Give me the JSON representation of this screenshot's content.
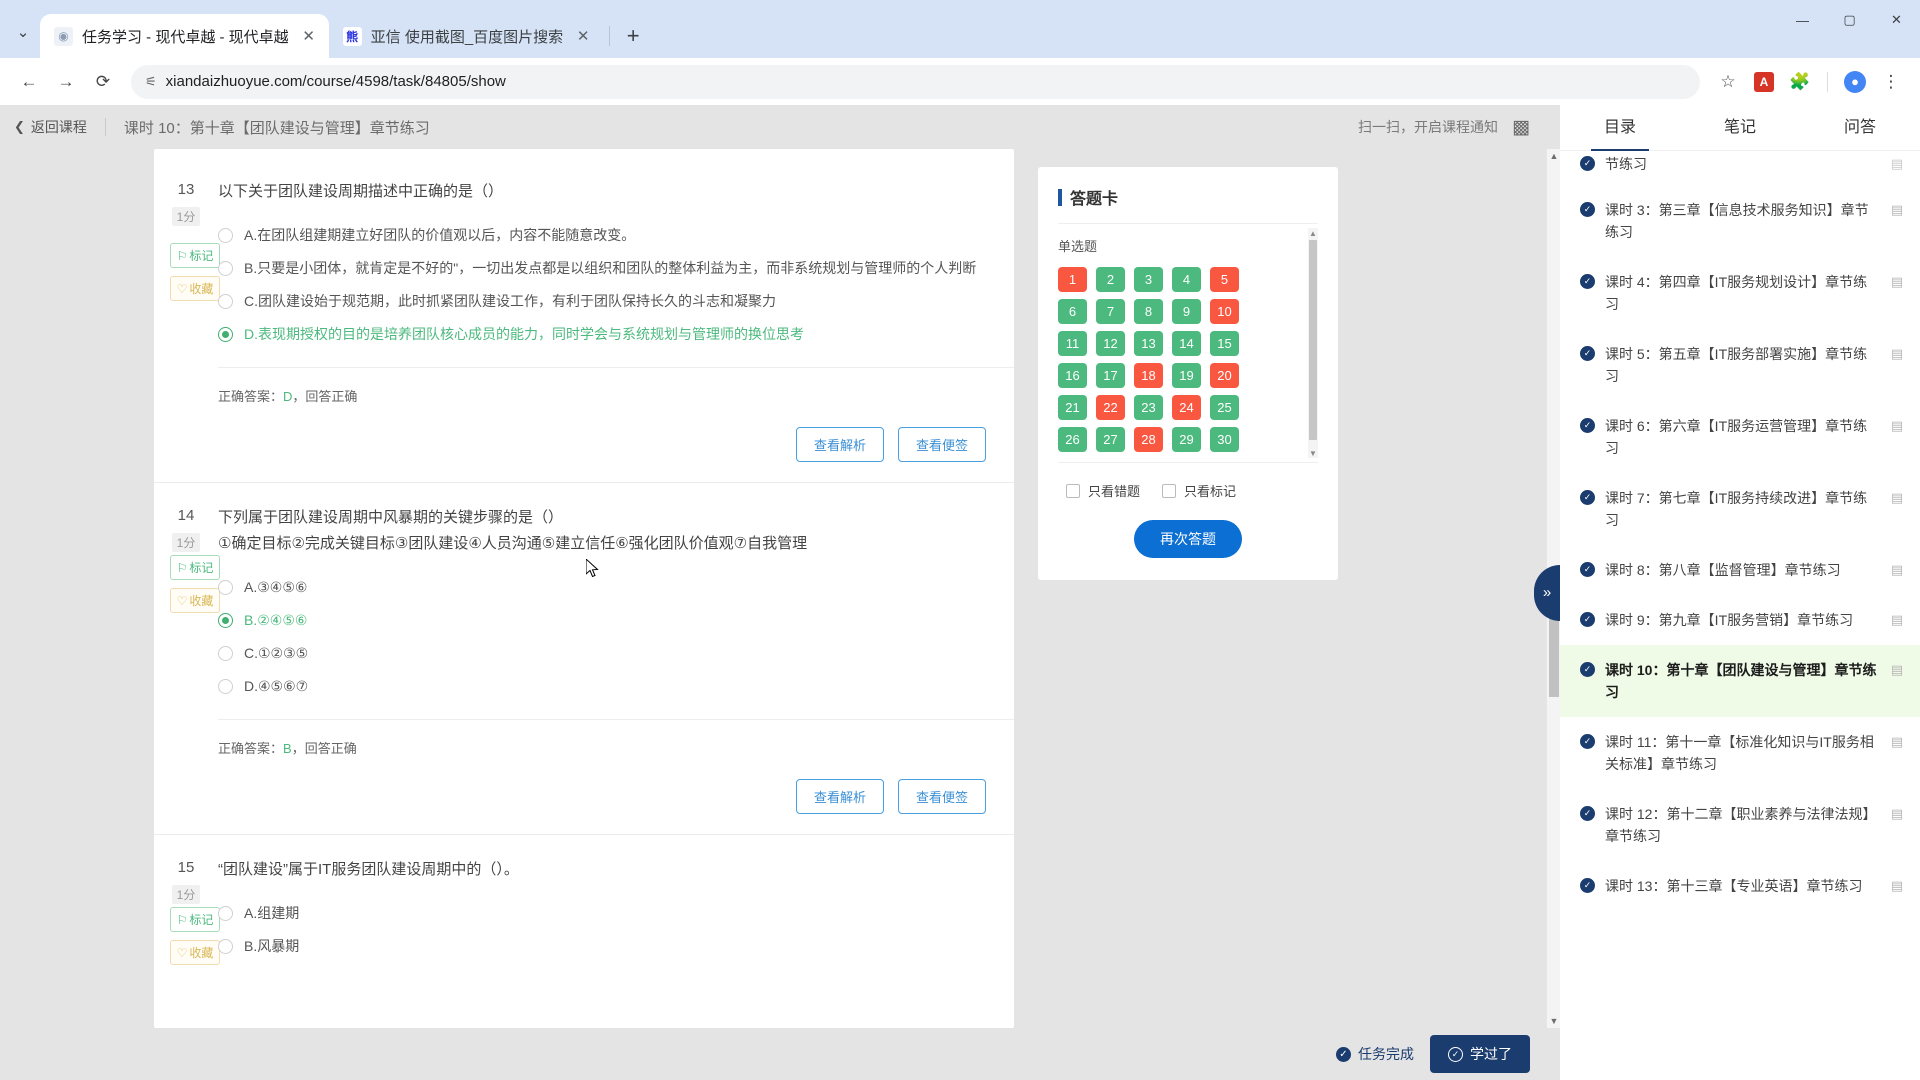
{
  "browser": {
    "tabs": [
      {
        "title": "任务学习 - 现代卓越 - 现代卓越",
        "favicon": "zhuoyue-icon",
        "active": true,
        "close_label": "✕"
      },
      {
        "title": "亚信 使用截图_百度图片搜索",
        "favicon": "baidu-icon",
        "active": false,
        "close_label": "✕"
      }
    ],
    "new_tab_label": "+",
    "tab_list_chevron": "⌄",
    "window_controls": {
      "minimize": "—",
      "maximize": "▢",
      "close": "✕"
    },
    "nav": {
      "back": "←",
      "forward": "→",
      "reload": "⟳"
    },
    "omnibox": {
      "url": "xiandaizhuoyue.com/course/4598/task/84805/show",
      "site_info_icon": "tune-icon"
    },
    "toolbar_right": {
      "bookmark": "☆",
      "pdf_ext": "PDF",
      "extensions": "⟐",
      "profile": "👤",
      "menu": "⋮"
    }
  },
  "page_header": {
    "back_label": "返回课程",
    "back_arrow": "❮",
    "title": "课时 10：第十章【团队建设与管理】章节练习",
    "scan_notice": "扫一扫，开启课程通知",
    "qr_icon": "qr-code-icon"
  },
  "questions": [
    {
      "number": "13",
      "score": "1分",
      "stem": "以下关于团队建设周期描述中正确的是（）",
      "stem2": "",
      "tags": [
        {
          "label": "标记",
          "icon": "flag-icon",
          "type": "mark"
        },
        {
          "label": "收藏",
          "icon": "heart-icon",
          "type": "favorite"
        }
      ],
      "options": [
        {
          "label": "A.在团队组建期建立好团队的价值观以后，内容不能随意改变。",
          "selected": false,
          "correct": false
        },
        {
          "label": "B.只要是小团体，就肯定是不好的\"，一切出发点都是以组织和团队的整体利益为主，而非系统规划与管理师的个人判断",
          "selected": false,
          "correct": false
        },
        {
          "label": "C.团队建设始于规范期，此时抓紧团队建设工作，有利于团队保持长久的斗志和凝聚力",
          "selected": false,
          "correct": false
        },
        {
          "label": "D.表现期授权的目的是培养团队核心成员的能力，同时学会与系统规划与管理师的换位思考",
          "selected": true,
          "correct": true
        }
      ],
      "answer_prefix": "正确答案：",
      "answer_key": "D",
      "answer_suffix": "，回答正确",
      "actions": [
        "查看解析",
        "查看便签"
      ]
    },
    {
      "number": "14",
      "score": "1分",
      "stem": "下列属于团队建设周期中风暴期的关键步骤的是（）",
      "stem2": "①确定目标②完成关键目标③团队建设④人员沟通⑤建立信任⑥强化团队价值观⑦自我管理",
      "tags": [
        {
          "label": "标记",
          "icon": "flag-icon",
          "type": "mark"
        },
        {
          "label": "收藏",
          "icon": "heart-icon",
          "type": "favorite"
        }
      ],
      "options": [
        {
          "label": "A.③④⑤⑥",
          "selected": false,
          "correct": false
        },
        {
          "label": "B.②④⑤⑥",
          "selected": true,
          "correct": true
        },
        {
          "label": "C.①②③⑤",
          "selected": false,
          "correct": false
        },
        {
          "label": "D.④⑤⑥⑦",
          "selected": false,
          "correct": false
        }
      ],
      "answer_prefix": "正确答案：",
      "answer_key": "B",
      "answer_suffix": "，回答正确",
      "actions": [
        "查看解析",
        "查看便签"
      ]
    },
    {
      "number": "15",
      "score": "1分",
      "stem": "“团队建设”属于IT服务团队建设周期中的（）。",
      "stem2": "",
      "tags": [
        {
          "label": "标记",
          "icon": "flag-icon",
          "type": "mark"
        }
      ],
      "options": [
        {
          "label": "A.组建期",
          "selected": false,
          "correct": false
        },
        {
          "label": "B.风暴期",
          "selected": false,
          "correct": false
        }
      ],
      "answer_prefix": "",
      "answer_key": "",
      "answer_suffix": "",
      "actions": []
    }
  ],
  "answer_card": {
    "title": "答题卡",
    "group_label": "单选题",
    "cells": [
      {
        "n": "1",
        "state": "bad"
      },
      {
        "n": "2",
        "state": "ok"
      },
      {
        "n": "3",
        "state": "ok"
      },
      {
        "n": "4",
        "state": "ok"
      },
      {
        "n": "5",
        "state": "bad"
      },
      {
        "n": "6",
        "state": "ok"
      },
      {
        "n": "7",
        "state": "ok"
      },
      {
        "n": "8",
        "state": "ok"
      },
      {
        "n": "9",
        "state": "ok"
      },
      {
        "n": "10",
        "state": "bad"
      },
      {
        "n": "11",
        "state": "ok"
      },
      {
        "n": "12",
        "state": "ok"
      },
      {
        "n": "13",
        "state": "ok"
      },
      {
        "n": "14",
        "state": "ok"
      },
      {
        "n": "15",
        "state": "ok"
      },
      {
        "n": "16",
        "state": "ok"
      },
      {
        "n": "17",
        "state": "ok"
      },
      {
        "n": "18",
        "state": "bad"
      },
      {
        "n": "19",
        "state": "ok"
      },
      {
        "n": "20",
        "state": "bad"
      },
      {
        "n": "21",
        "state": "ok"
      },
      {
        "n": "22",
        "state": "bad"
      },
      {
        "n": "23",
        "state": "ok"
      },
      {
        "n": "24",
        "state": "bad"
      },
      {
        "n": "25",
        "state": "ok"
      },
      {
        "n": "26",
        "state": "ok"
      },
      {
        "n": "27",
        "state": "ok"
      },
      {
        "n": "28",
        "state": "bad"
      },
      {
        "n": "29",
        "state": "ok"
      },
      {
        "n": "30",
        "state": "ok"
      }
    ],
    "checkboxes": [
      {
        "label": "只看错题",
        "checked": false
      },
      {
        "label": "只看标记",
        "checked": false
      }
    ],
    "submit_label": "再次答题",
    "colors": {
      "correct": "#4cb97e",
      "wrong": "#fa5741",
      "primary": "#0b6fd4"
    }
  },
  "bottom_bar": {
    "task_done_label": "任务完成",
    "studied_label": "学过了",
    "check_icon": "check-circle-icon"
  },
  "sidebar": {
    "tabs": [
      {
        "label": "目录",
        "active": true
      },
      {
        "label": "笔记",
        "active": false
      },
      {
        "label": "问答",
        "active": false
      }
    ],
    "collapse_icon": "chevron-double-right-icon",
    "items": [
      {
        "label": "节练习",
        "current": false,
        "partial": true
      },
      {
        "label": "课时 3：第三章【信息技术服务知识】章节练习",
        "current": false
      },
      {
        "label": "课时 4：第四章【IT服务规划设计】章节练习",
        "current": false
      },
      {
        "label": "课时 5：第五章【IT服务部署实施】章节练习",
        "current": false
      },
      {
        "label": "课时 6：第六章【IT服务运营管理】章节练习",
        "current": false
      },
      {
        "label": "课时 7：第七章【IT服务持续改进】章节练习",
        "current": false
      },
      {
        "label": "课时 8：第八章【监督管理】章节练习",
        "current": false
      },
      {
        "label": "课时 9：第九章【IT服务营销】章节练习",
        "current": false
      },
      {
        "label": "课时 10：第十章【团队建设与管理】章节练习",
        "current": true
      },
      {
        "label": "课时 11：第十一章【标准化知识与IT服务相关标准】章节练习",
        "current": false
      },
      {
        "label": "课时 12：第十二章【职业素养与法律法规】章节练习",
        "current": false
      },
      {
        "label": "课时 13：第十三章【专业英语】章节练习",
        "current": false
      }
    ]
  }
}
